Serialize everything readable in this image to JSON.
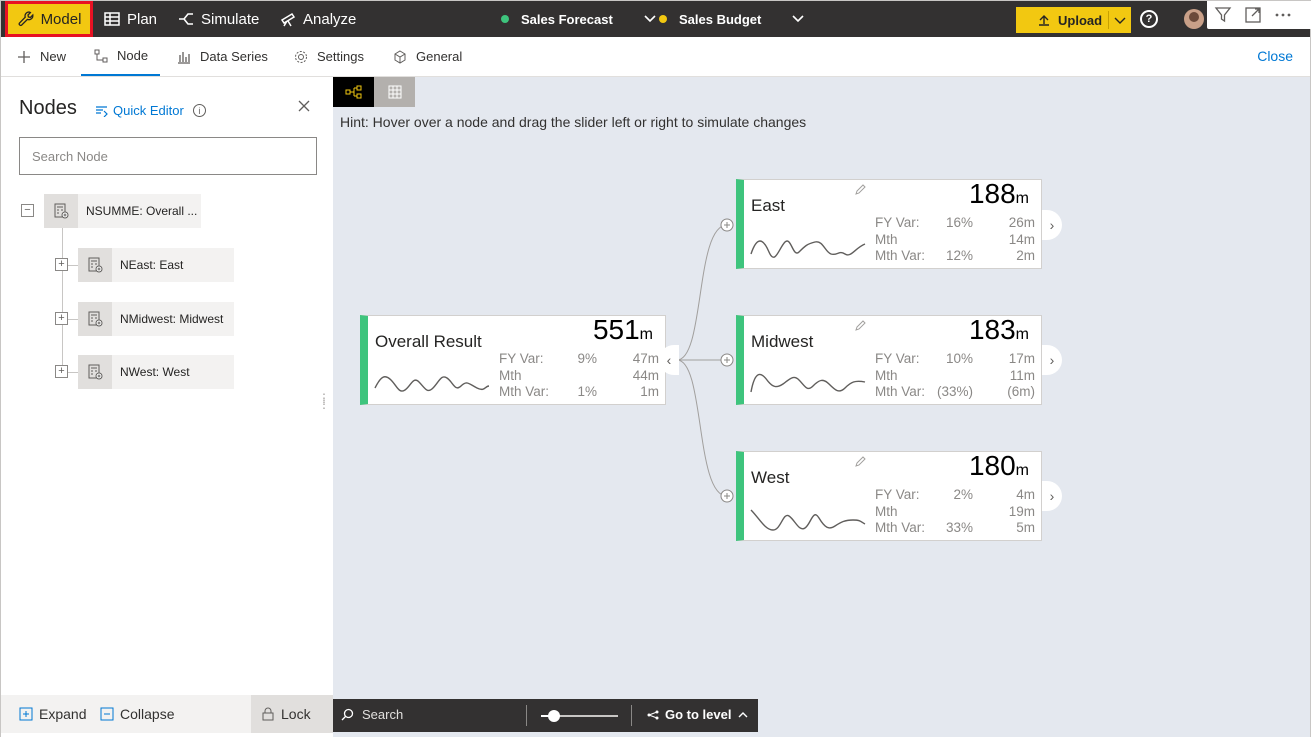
{
  "topbar": {
    "model_label": "Model",
    "plan_label": "Plan",
    "simulate_label": "Simulate",
    "analyze_label": "Analyze",
    "scenario_1": {
      "label": "Sales Forecast",
      "color": "#3ec47d"
    },
    "scenario_2": {
      "label": "Sales Budget",
      "color": "#f2c811"
    },
    "upload_label": "Upload",
    "help_glyph": "?"
  },
  "tabs": {
    "new_label": "New",
    "node_label": "Node",
    "data_series_label": "Data Series",
    "settings_label": "Settings",
    "general_label": "General",
    "close_label": "Close"
  },
  "panel": {
    "title": "Nodes",
    "quick_editor_label": "Quick Editor",
    "search_placeholder": "Search Node",
    "tree": [
      {
        "label": "NSUMME: Overall ...",
        "toggle": "−"
      },
      {
        "label": "NEast: East",
        "toggle": "+"
      },
      {
        "label": "NMidwest: Midwest",
        "toggle": "+"
      },
      {
        "label": "NWest: West",
        "toggle": "+"
      }
    ],
    "footer": {
      "expand_label": "Expand",
      "collapse_label": "Collapse",
      "lock_label": "Lock"
    }
  },
  "canvas": {
    "hint": "Hint: Hover over a node and drag the slider left or right to simulate changes",
    "accent_color": "#3ec47d",
    "nodes": [
      {
        "name": "Overall Result",
        "value": "551",
        "unit": "m",
        "metrics": [
          {
            "label": "FY Var:",
            "pct": "9%",
            "val": "47m"
          },
          {
            "label": "Mth",
            "pct": "",
            "val": "44m"
          },
          {
            "label": "Mth Var:",
            "pct": "1%",
            "val": "1m"
          }
        ]
      },
      {
        "name": "East",
        "value": "188",
        "unit": "m",
        "metrics": [
          {
            "label": "FY Var:",
            "pct": "16%",
            "val": "26m"
          },
          {
            "label": "Mth",
            "pct": "",
            "val": "14m"
          },
          {
            "label": "Mth Var:",
            "pct": "12%",
            "val": "2m"
          }
        ]
      },
      {
        "name": "Midwest",
        "value": "183",
        "unit": "m",
        "metrics": [
          {
            "label": "FY Var:",
            "pct": "10%",
            "val": "17m"
          },
          {
            "label": "Mth",
            "pct": "",
            "val": "11m"
          },
          {
            "label": "Mth Var:",
            "pct": "(33%)",
            "val": "(6m)"
          }
        ]
      },
      {
        "name": "West",
        "value": "180",
        "unit": "m",
        "metrics": [
          {
            "label": "FY Var:",
            "pct": "2%",
            "val": "4m"
          },
          {
            "label": "Mth",
            "pct": "",
            "val": "19m"
          },
          {
            "label": "Mth Var:",
            "pct": "33%",
            "val": "5m"
          }
        ]
      }
    ]
  },
  "bottom_toolbar": {
    "search_placeholder": "Search",
    "goto_label": "Go to level"
  }
}
